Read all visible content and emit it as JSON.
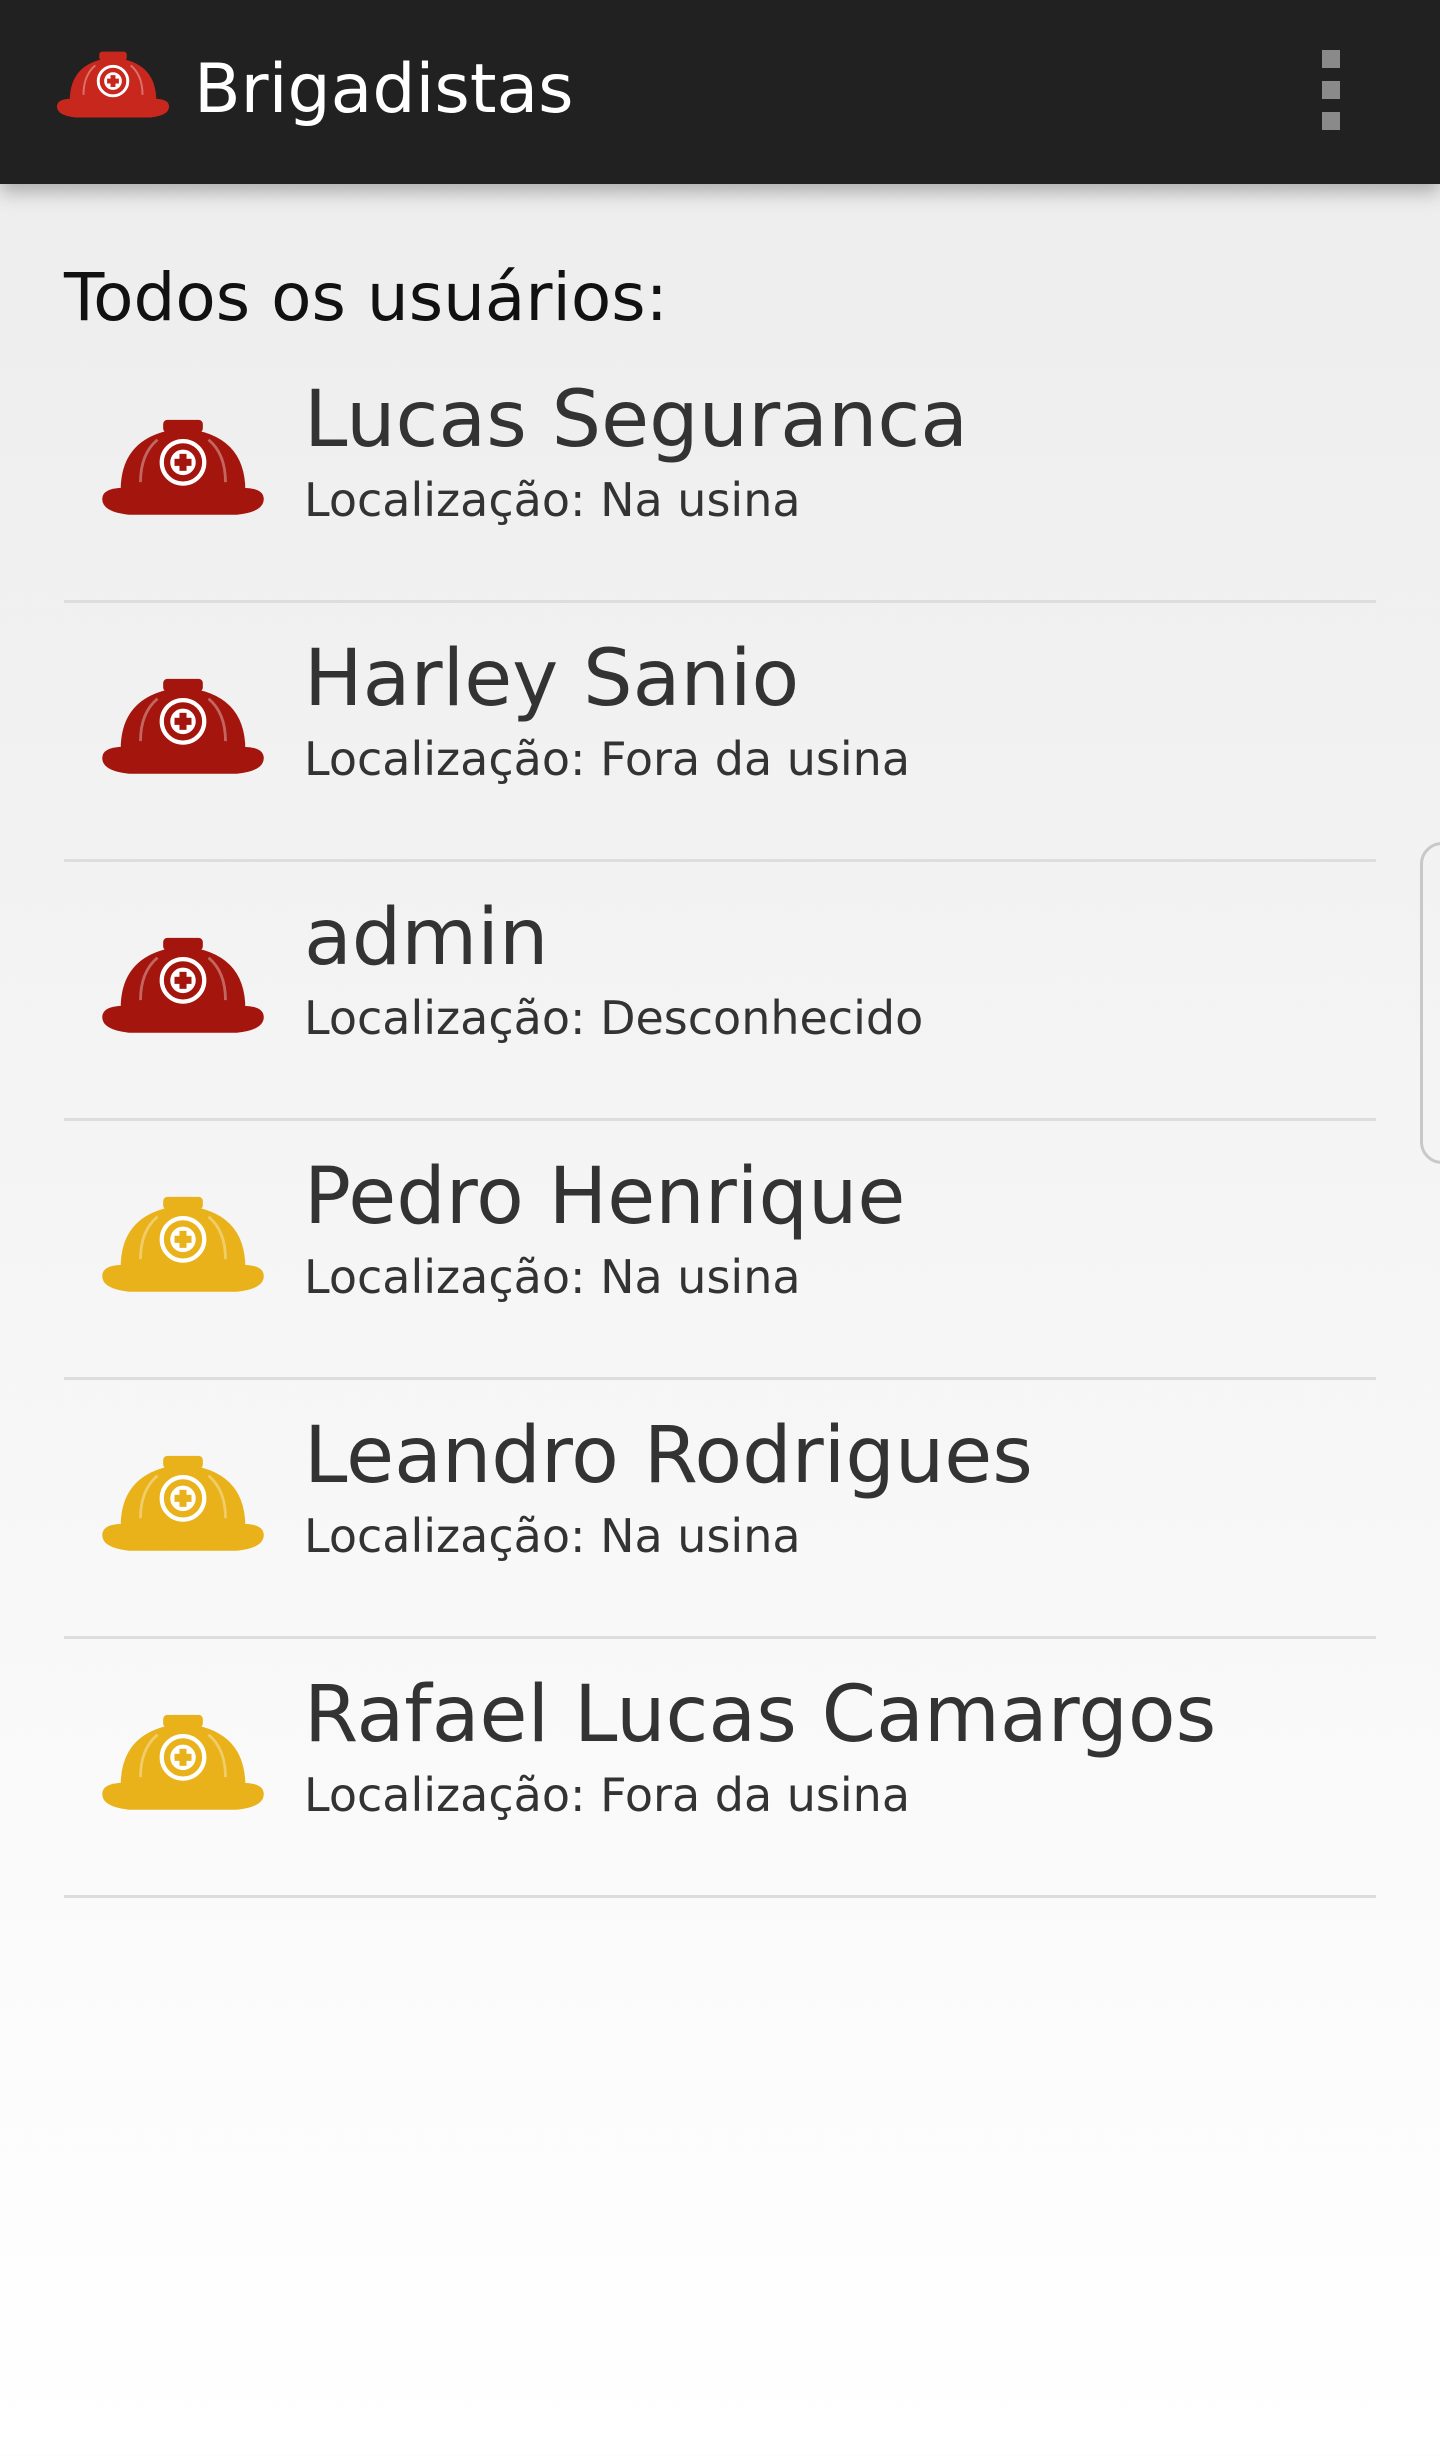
{
  "app_bar": {
    "title": "Brigadistas",
    "logo_icon": "red-helmet-icon",
    "overflow_icon": "more-vert-icon"
  },
  "section": {
    "title": "Todos os usuários:"
  },
  "users": [
    {
      "name": "Lucas Seguranca",
      "location": "Localização: Na usina",
      "helmet_color": "#A3150D",
      "helmet_icon": "red-helmet-icon"
    },
    {
      "name": "Harley Sanio",
      "location": "Localização: Fora da usina",
      "helmet_color": "#A3150D",
      "helmet_icon": "red-helmet-icon"
    },
    {
      "name": "admin",
      "location": "Localização: Desconhecido",
      "helmet_color": "#A3150D",
      "helmet_icon": "red-helmet-icon"
    },
    {
      "name": "Pedro Henrique",
      "location": "Localização: Na usina",
      "helmet_color": "#E9B21A",
      "helmet_icon": "yellow-helmet-icon"
    },
    {
      "name": "Leandro Rodrigues",
      "location": "Localização: Na usina",
      "helmet_color": "#E9B21A",
      "helmet_icon": "yellow-helmet-icon"
    },
    {
      "name": "Rafael Lucas Camargos",
      "location": "Localização: Fora da usina",
      "helmet_color": "#E9B21A",
      "helmet_icon": "yellow-helmet-icon"
    }
  ],
  "colors": {
    "app_bar": "#212121",
    "title_text": "#FFFFFF",
    "item_text": "#333333",
    "divider": "#DDDDDD"
  }
}
